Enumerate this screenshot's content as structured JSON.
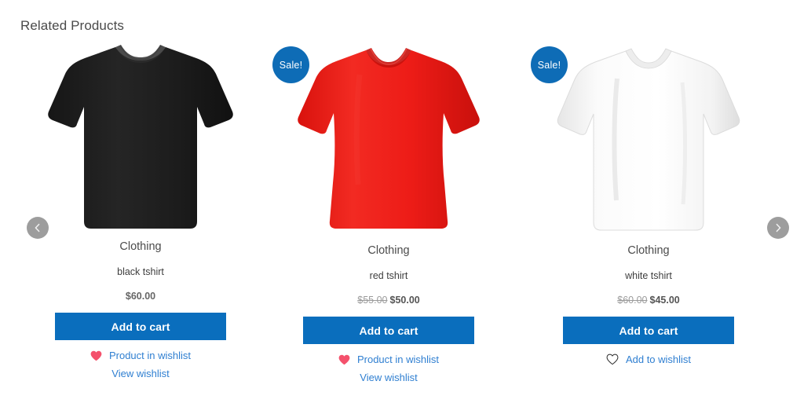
{
  "section": {
    "title": "Related Products"
  },
  "carousel": {
    "prev_icon": "chevron-left-icon",
    "next_icon": "chevron-right-icon",
    "accent_color": "#0a6ebd",
    "badge_color": "#0e6cb6",
    "link_color": "#2f7fd1",
    "heart_color": "#f4516c",
    "nav_color": "#9d9d9d"
  },
  "products": [
    {
      "badge": "",
      "has_badge": false,
      "image": "black-tshirt-image",
      "shirt_color": "#1b1b1b",
      "category": "Clothing",
      "name": "black tshirt",
      "price_old": "",
      "price": "$60.00",
      "on_sale": false,
      "add_to_cart": "Add to cart",
      "wishlist_label": "Product in wishlist",
      "wishlist_icon": "heart-filled-icon",
      "in_wishlist": true,
      "view_wishlist": "View wishlist"
    },
    {
      "badge": "Sale!",
      "has_badge": true,
      "image": "red-tshirt-image",
      "shirt_color": "#ed1c17",
      "category": "Clothing",
      "name": "red tshirt",
      "price_old": "$55.00",
      "price": "$50.00",
      "on_sale": true,
      "add_to_cart": "Add to cart",
      "wishlist_label": "Product in wishlist",
      "wishlist_icon": "heart-filled-icon",
      "in_wishlist": true,
      "view_wishlist": "View wishlist"
    },
    {
      "badge": "Sale!",
      "has_badge": true,
      "image": "white-tshirt-image",
      "shirt_color": "#fdfdfd",
      "category": "Clothing",
      "name": "white tshirt",
      "price_old": "$60.00",
      "price": "$45.00",
      "on_sale": true,
      "add_to_cart": "Add to cart",
      "wishlist_label": "Add to wishlist",
      "wishlist_icon": "heart-outline-icon",
      "in_wishlist": false,
      "view_wishlist": ""
    }
  ]
}
